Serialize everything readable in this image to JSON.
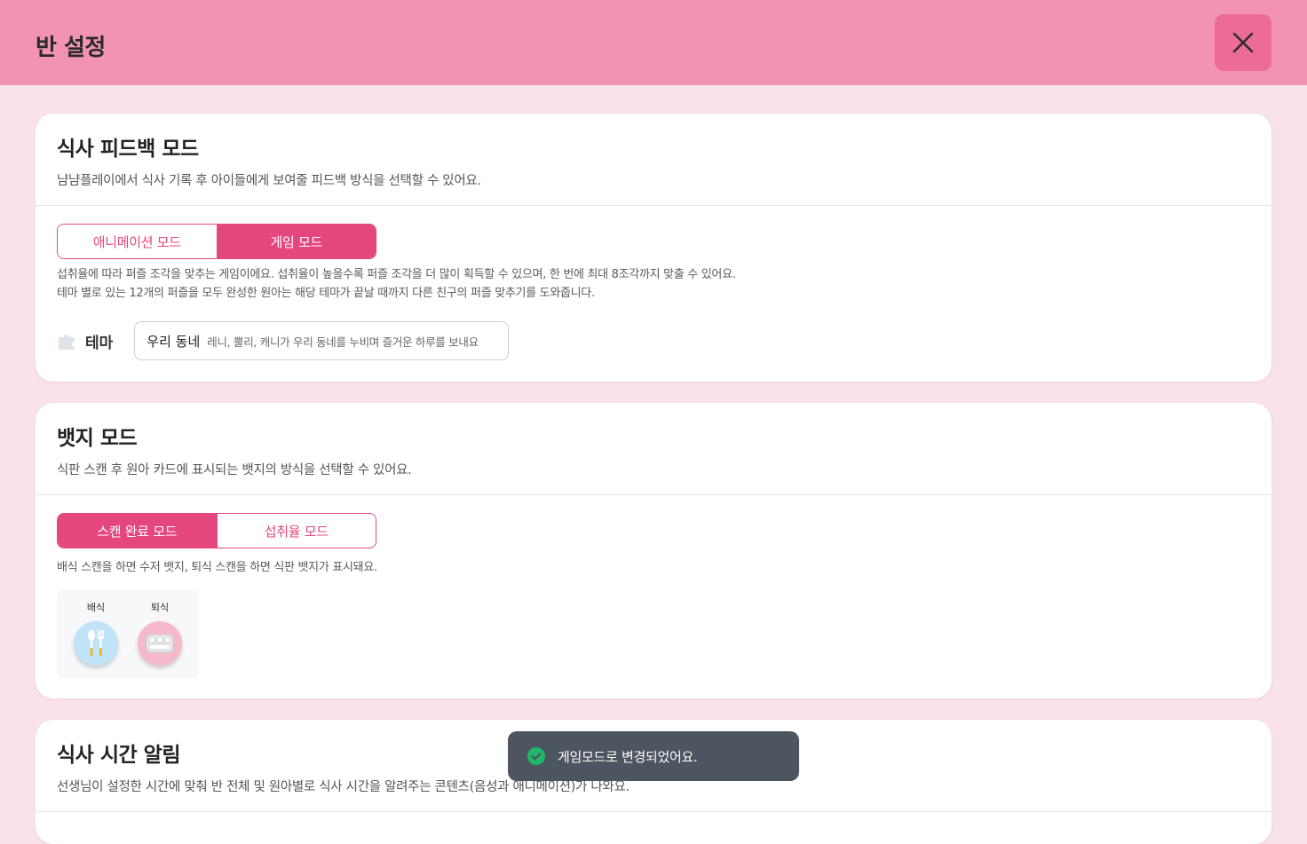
{
  "header": {
    "title": "반 설정"
  },
  "meal_feedback": {
    "title": "식사 피드백 모드",
    "description": "냠냠플레이에서 식사 기록 후 아이들에게 보여줄 피드백 방식을 선택할 수 있어요.",
    "tabs": [
      {
        "label": "애니메이션 모드",
        "active": false
      },
      {
        "label": "게임 모드",
        "active": true
      }
    ],
    "help_line1": "섭취율에 따라 퍼즐 조각을 맞추는 게임이에요. 섭취율이 높을수록 퍼즐 조각을 더 많이 획득할 수 있으며, 한 번에 최대 8조각까지 맞출 수 있어요.",
    "help_line2": "테마 별로 있는 12개의 퍼즐을 모두 완성한 원아는 해당 테마가 끝날 때까지 다른 친구의 퍼즐 맞추기를 도와줍니다.",
    "theme_label": "테마",
    "theme_icon": "puzzle-icon",
    "theme_value": "우리 동네",
    "theme_sub": "레니, 뿔리, 캐니가 우리 동네를 누비며 즐거운 하루를 보내요"
  },
  "badge_mode": {
    "title": "뱃지 모드",
    "description": "식판 스캔 후 원아 카드에 표시되는 뱃지의 방식을 선택할 수 있어요.",
    "tabs": [
      {
        "label": "스캔 완료 모드",
        "active": true
      },
      {
        "label": "섭취율 모드",
        "active": false
      }
    ],
    "help": "배식 스캔을 하면 수저 뱃지, 퇴식 스캔을 하면 식판 뱃지가 표시돼요.",
    "badges": [
      {
        "label": "배식",
        "icon": "spoon-fork-icon",
        "color": "#bfe3f7"
      },
      {
        "label": "퇴식",
        "icon": "tray-icon",
        "color": "#f6b9cc"
      }
    ]
  },
  "meal_alert": {
    "title": "식사 시간 알림",
    "description": "선생님이 설정한 시간에 맞춰 반 전체 및 원아별로 식사 시간을 알려주는 콘텐츠(음성과 애니메이션)가 나와요."
  },
  "toast": {
    "message": "게임모드로 변경되었어요."
  },
  "colors": {
    "accent": "#e4477e",
    "header": "#f293b3",
    "page_bg": "#f9e2ea",
    "success": "#1fb76a"
  }
}
